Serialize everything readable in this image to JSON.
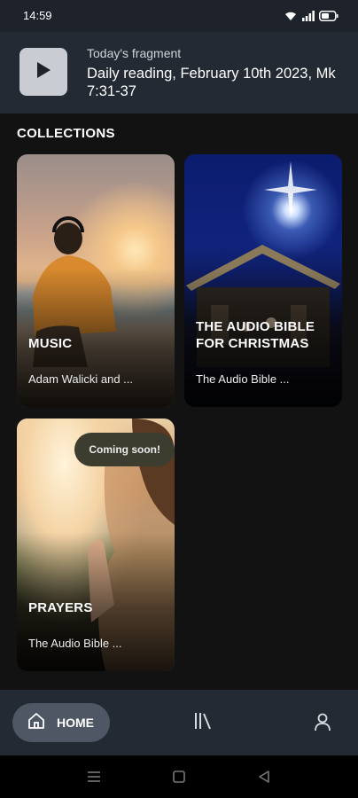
{
  "status_bar": {
    "time": "14:59",
    "icons": [
      "wifi-icon",
      "signal-icon",
      "battery-icon"
    ]
  },
  "fragment": {
    "label": "Today's fragment",
    "title": "Daily reading, February 10th 2023, Mk 7:31-37",
    "icon": "play-icon"
  },
  "collections": {
    "heading": "COLLECTIONS",
    "items": [
      {
        "title": "MUSIC",
        "subtitle": "Adam Walicki and ..."
      },
      {
        "title": "THE AUDIO BIBLE FOR CHRISTMAS",
        "subtitle": "The Audio Bible ..."
      },
      {
        "title": "PRAYERS",
        "subtitle": "The Audio Bible ...",
        "badge": "Coming soon!"
      }
    ]
  },
  "bottom_nav": {
    "home_label": "HOME",
    "items": [
      "home-icon",
      "library-icon",
      "profile-icon"
    ]
  },
  "system_nav": [
    "menu-icon",
    "home-square-icon",
    "back-icon"
  ],
  "colors": {
    "background": "#121212",
    "header": "#232a33",
    "nav_active": "#4e5763",
    "badge": "#3c3c2f"
  }
}
